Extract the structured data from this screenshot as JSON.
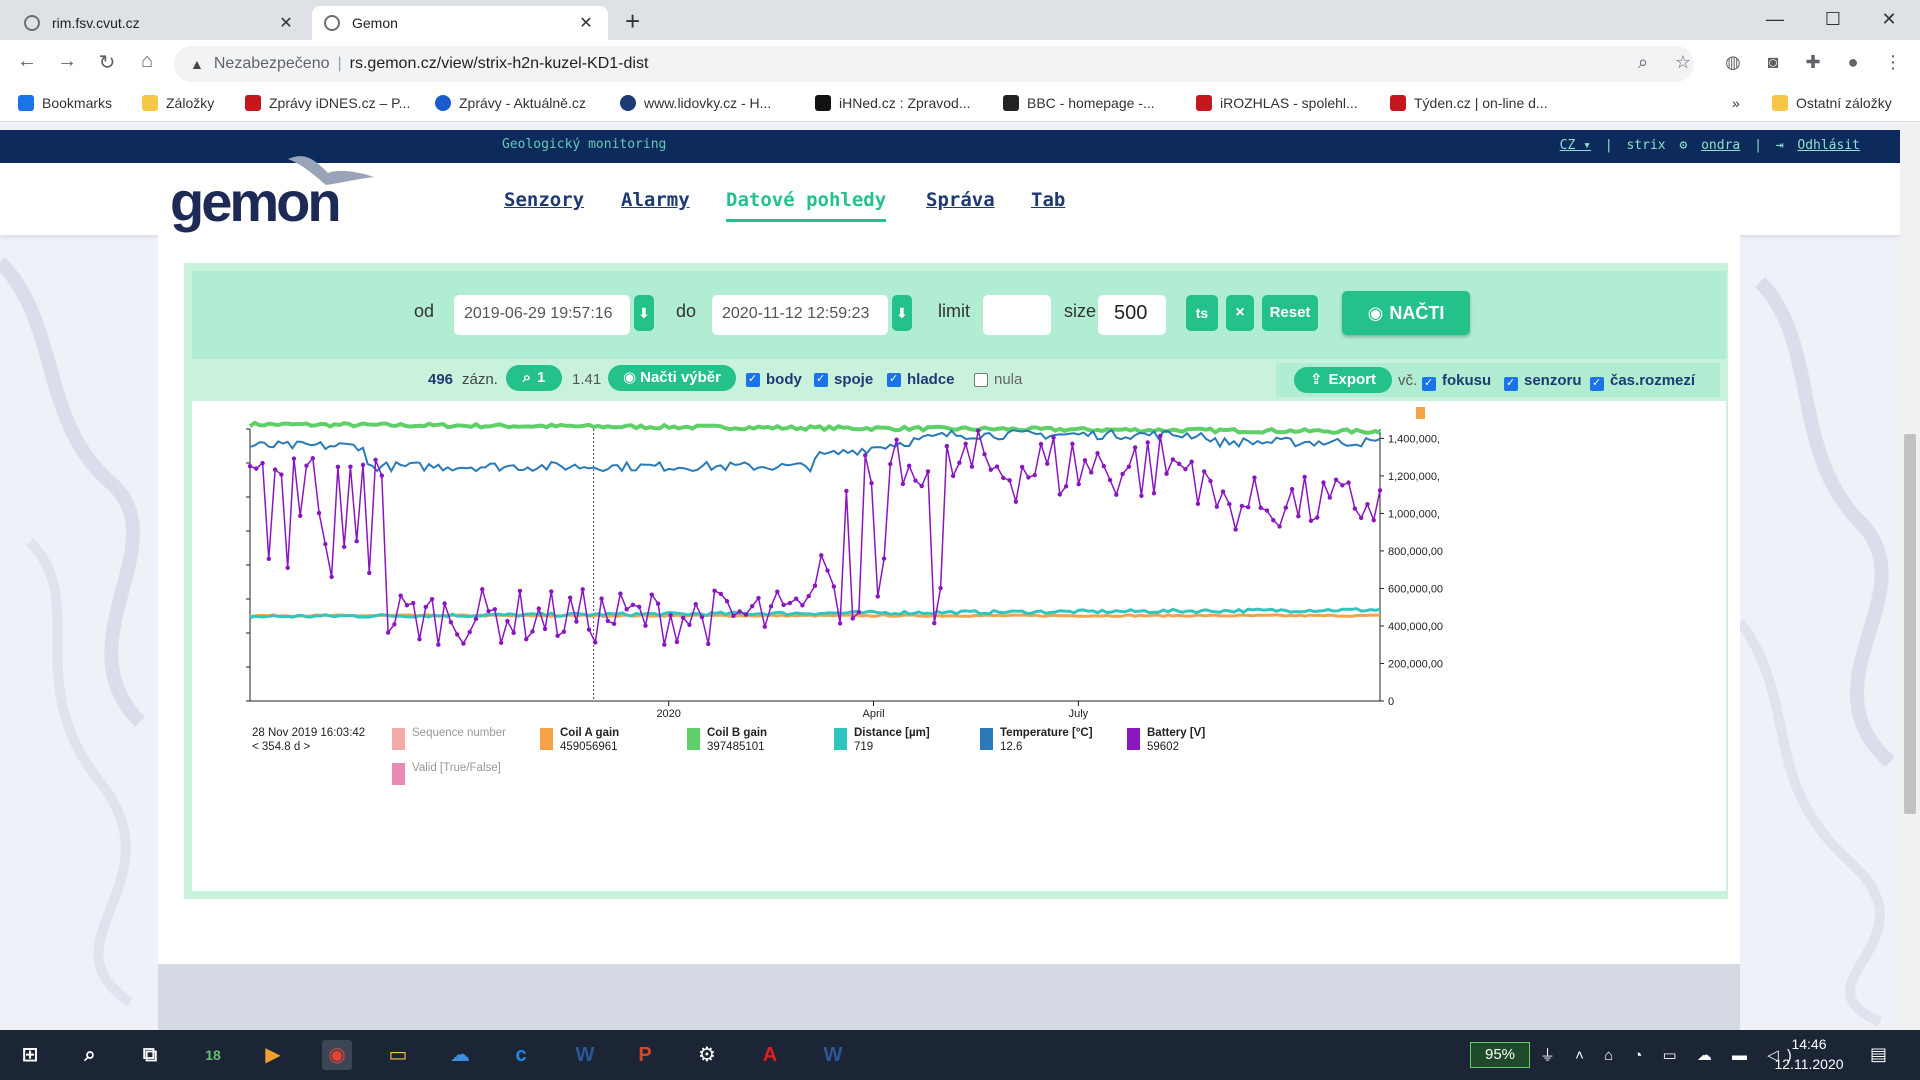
{
  "browser": {
    "tabs": [
      {
        "title": "rim.fsv.cvut.cz",
        "close": "✕"
      },
      {
        "title": "Gemon",
        "close": "✕"
      }
    ],
    "new_tab": "+",
    "window": {
      "minimize": "—",
      "maximize": "☐",
      "close": "✕"
    },
    "nav": {
      "back": "←",
      "forward": "→",
      "reload": "↻",
      "home": "⌂"
    },
    "address": {
      "security": "Nezabezpečeno",
      "separator": "|",
      "url": "rs.gemon.cz/view/strix-h2n-kuzel-KD1-dist"
    },
    "bookmarks": [
      {
        "label": "Bookmarks",
        "color": "#1a73e8"
      },
      {
        "label": "Záložky",
        "color": "#f6c744"
      },
      {
        "label": "Zprávy iDNES.cz – P...",
        "color": "#c4161c"
      },
      {
        "label": "Zprávy - Aktuálně.cz",
        "color": "#1a5ccc"
      },
      {
        "label": "www.lidovky.cz - H...",
        "color": "#1d3a75"
      },
      {
        "label": "iHNed.cz : Zpravod...",
        "color": "#111111"
      },
      {
        "label": "BBC - homepage -...",
        "color": "#222222"
      },
      {
        "label": "iROZHLAS - spolehl...",
        "color": "#c4161c"
      },
      {
        "label": "Týden.cz | on-line d...",
        "color": "#c4161c"
      }
    ],
    "more_bookmarks": "»",
    "other_bookmarks": "Ostatní záložky"
  },
  "site": {
    "subtitle": "Geologický monitoring",
    "lang": "CZ ▾",
    "project": "strix",
    "user": "ondra",
    "logout": "Odhlásit",
    "logo": "gemon",
    "menu": [
      "Senzory",
      "Alarmy",
      "Datové pohledy",
      "Správa",
      "Tab"
    ],
    "active_menu": "Datové pohledy"
  },
  "controls": {
    "from_label": "od",
    "from_value": "2019-06-29 19:57:16",
    "to_label": "do",
    "to_value": "2020-11-12 12:59:23",
    "limit_label": "limit",
    "limit_value": "",
    "size_label": "size",
    "size_value": "500",
    "ts_button": "ts",
    "clear_button": "×",
    "reset_button": "Reset",
    "load_button": "NAČTI"
  },
  "subbar": {
    "records_count": "496",
    "records_label": "zázn.",
    "zoom_value": "1",
    "ratio": "1.41",
    "load_selection": "Načti výběr",
    "checkboxes_left": [
      {
        "label": "body",
        "checked": true
      },
      {
        "label": "spoje",
        "checked": true
      },
      {
        "label": "hladce",
        "checked": true
      },
      {
        "label": "nula",
        "checked": false
      }
    ],
    "export_button": "Export",
    "incl_label": "vč.",
    "checkboxes_right": [
      {
        "label": "fokusu",
        "checked": true
      },
      {
        "label": "senzoru",
        "checked": true
      },
      {
        "label": "čas.rozmezí",
        "checked": true
      }
    ]
  },
  "chart_data": {
    "type": "line",
    "x_start": "2019-06-29",
    "x_end": "2020-11-12",
    "x_tick_labels": [
      "2020",
      "April",
      "July"
    ],
    "y_right_ticks": [
      "0",
      "200,000,00",
      "400,000,00",
      "600,000,00",
      "800,000,00",
      "1,000,000,",
      "1,200,000,",
      "1,400,000,"
    ],
    "y_right_values": [
      0,
      200000000,
      400000000,
      600000000,
      800000000,
      1000000000,
      1200000000,
      1400000000
    ],
    "cursor": {
      "time": "28 Nov 2019 16:03:42",
      "range": "< 354.8 d >"
    },
    "series": [
      {
        "name": "Sequence number",
        "color": "#f4aaa7",
        "value": "",
        "visible": false
      },
      {
        "name": "Coil A gain",
        "color": "#f5a34b",
        "value": "459056961",
        "visible": true
      },
      {
        "name": "Coil B gain",
        "color": "#5fd068",
        "value": "397485101",
        "visible": true
      },
      {
        "name": "Distance [µm]",
        "color": "#30c6c0",
        "value": "719",
        "visible": true
      },
      {
        "name": "Temperature [°C]",
        "color": "#2a7ab8",
        "value": "12.6",
        "visible": true
      },
      {
        "name": "Battery [V]",
        "color": "#8a16c2",
        "value": "59602",
        "visible": true
      },
      {
        "name": "Valid [True/False]",
        "color": "#e88bb4",
        "value": "",
        "visible": false
      }
    ]
  },
  "taskbar": {
    "apps": [
      {
        "name": "windows",
        "label": "⊞",
        "color": "#ffffff"
      },
      {
        "name": "search",
        "label": "⌕",
        "color": "#ffffff"
      },
      {
        "name": "task-view",
        "label": "⧉",
        "color": "#ffffff"
      },
      {
        "name": "calendar",
        "label": "18",
        "color": "#5ec46a"
      },
      {
        "name": "media",
        "label": "▶",
        "color": "#f0a030"
      },
      {
        "name": "chrome",
        "label": "◉",
        "color": "#e94235"
      },
      {
        "name": "explorer",
        "label": "▭",
        "color": "#f5c342"
      },
      {
        "name": "app1",
        "label": "☁",
        "color": "#3d8ee0"
      },
      {
        "name": "app2",
        "label": "c",
        "color": "#1d8ae8"
      },
      {
        "name": "word",
        "label": "W",
        "color": "#2b5797"
      },
      {
        "name": "powerpoint",
        "label": "P",
        "color": "#d24726"
      },
      {
        "name": "settings",
        "label": "⚙",
        "color": "#ffffff"
      },
      {
        "name": "acrobat",
        "label": "A",
        "color": "#e02020"
      },
      {
        "name": "word2",
        "label": "W",
        "color": "#2b5797"
      }
    ],
    "battery": "95%",
    "time": "14:46",
    "date": "12.11.2020"
  }
}
